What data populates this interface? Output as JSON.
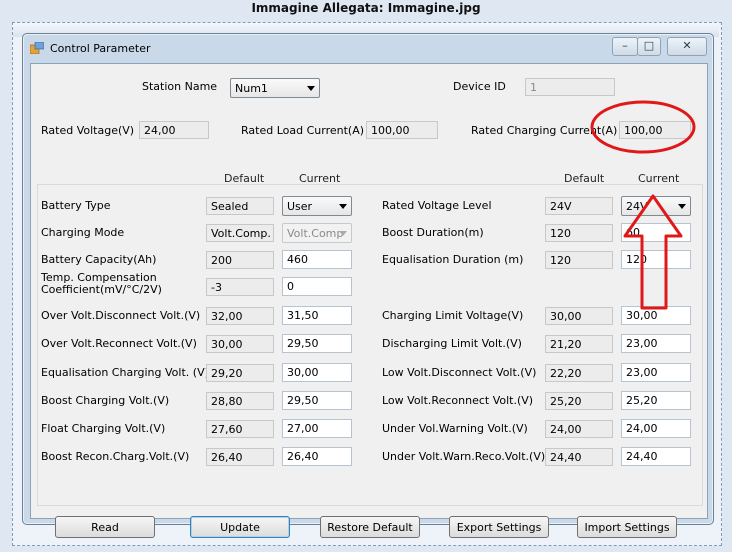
{
  "caption": "Immagine Allegata: Immagine.jpg",
  "window": {
    "title": "Control Parameter",
    "minimize_glyph": "–",
    "maximize_glyph": "□",
    "close_glyph": "✕"
  },
  "top": {
    "station_name_label": "Station Name",
    "station_name_value": "Num1",
    "device_id_label": "Device ID",
    "device_id_value": "1",
    "rated_voltage_label": "Rated Voltage(V)",
    "rated_voltage_value": "24,00",
    "rated_load_current_label": "Rated Load Current(A)",
    "rated_load_current_value": "100,00",
    "rated_charging_current_label": "Rated Charging Current(A)",
    "rated_charging_current_value": "100,00"
  },
  "headers": {
    "default": "Default",
    "current": "Current"
  },
  "left_rows": [
    {
      "label": "Battery Type",
      "default": "Sealed",
      "current": "User"
    },
    {
      "label": "Charging Mode",
      "default": "Volt.Comp.",
      "current": "Volt.Comp"
    },
    {
      "label": "Battery Capacity(Ah)",
      "default": "200",
      "current": "460"
    },
    {
      "label": "Temp. Compensation",
      "label2": "Coefficient(mV/°C/2V)",
      "default": "-3",
      "current": "0"
    },
    {
      "label": "Over Volt.Disconnect Volt.(V)",
      "default": "32,00",
      "current": "31,50"
    },
    {
      "label": "Over Volt.Reconnect Volt.(V)",
      "default": "30,00",
      "current": "29,50"
    },
    {
      "label": "Equalisation Charging Volt. (V)",
      "default": "29,20",
      "current": "30,00"
    },
    {
      "label": "Boost Charging Volt.(V)",
      "default": "28,80",
      "current": "29,50"
    },
    {
      "label": "Float Charging Volt.(V)",
      "default": "27,60",
      "current": "27,00"
    },
    {
      "label": "Boost Recon.Charg.Volt.(V)",
      "default": "26,40",
      "current": "26,40"
    }
  ],
  "right_rows": [
    {
      "label": "Rated Voltage Level",
      "default": "24V",
      "current": "24V"
    },
    {
      "label": "Boost Duration(m)",
      "default": "120",
      "current": "60"
    },
    {
      "label": "Equalisation Duration (m)",
      "default": "120",
      "current": "120"
    },
    {
      "label": "Charging Limit Voltage(V)",
      "default": "30,00",
      "current": "30,00"
    },
    {
      "label": "Discharging Limit Volt.(V)",
      "default": "21,20",
      "current": "23,00"
    },
    {
      "label": "Low Volt.Disconnect Volt.(V)",
      "default": "22,20",
      "current": "23,00"
    },
    {
      "label": "Low Volt.Reconnect Volt.(V)",
      "default": "25,20",
      "current": "25,20"
    },
    {
      "label": "Under Vol.Warning Volt.(V)",
      "default": "24,00",
      "current": "24,00"
    },
    {
      "label": "Under Volt.Warn.Reco.Volt.(V)",
      "default": "24,40",
      "current": "24,40"
    }
  ],
  "buttons": {
    "read": "Read",
    "update": "Update",
    "restore": "Restore Default",
    "export": "Export Settings",
    "import": "Import Settings"
  },
  "annotation_color": "#e01818"
}
